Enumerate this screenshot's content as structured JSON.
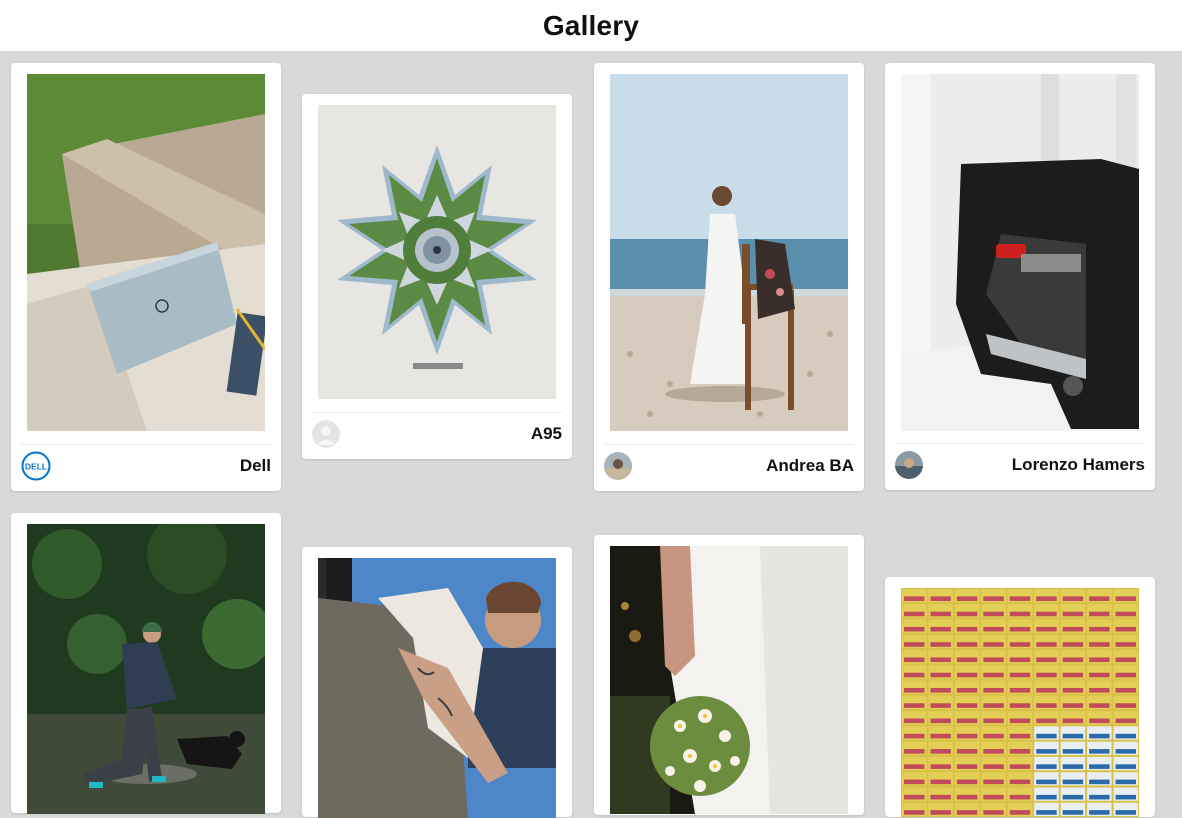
{
  "page": {
    "title": "Gallery"
  },
  "cards": [
    {
      "author": "Dell",
      "avatar_icon": "dell-logo-avatar",
      "photo": "laptop-on-marble-bench"
    },
    {
      "author": "A95",
      "avatar_icon": "default-user-avatar",
      "photo": "aerial-star-garden"
    },
    {
      "author": "Andrea BA",
      "avatar_icon": "user-photo-avatar",
      "photo": "woman-on-beach-with-chair"
    },
    {
      "author": "Lorenzo Hamers",
      "avatar_icon": "user-photo-avatar",
      "photo": "covered-sports-car"
    },
    {
      "author": "",
      "photo": "man-with-dog-in-stream"
    },
    {
      "author": "",
      "photo": "tattooed-man-with-camera-rig"
    },
    {
      "author": "",
      "photo": "bride-holding-bouquet"
    },
    {
      "author": "",
      "photo": "aerial-building-balconies"
    }
  ],
  "colors": {
    "background": "#d9d9d9",
    "card": "#ffffff",
    "dell_blue": "#0076ce"
  }
}
